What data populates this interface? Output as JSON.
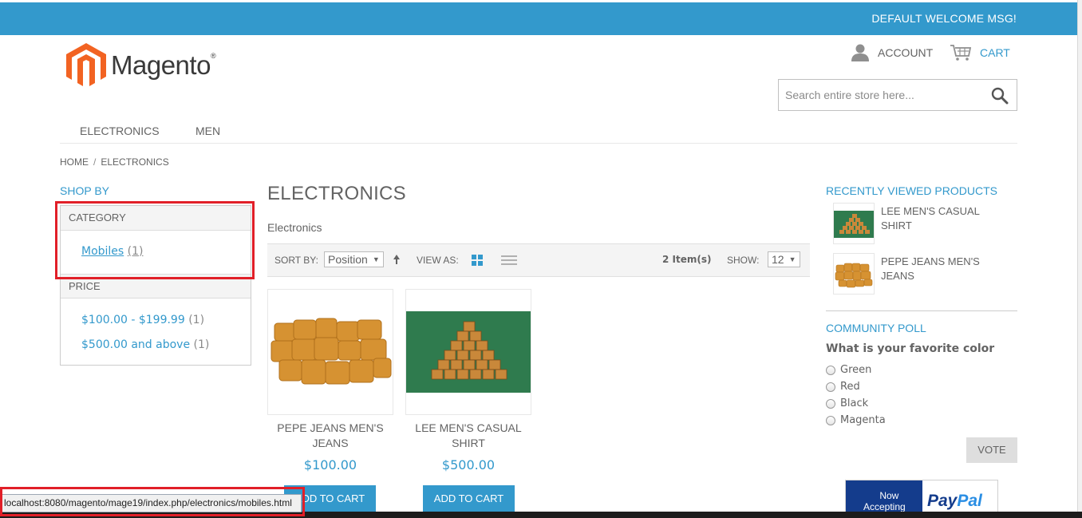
{
  "header": {
    "welcome": "DEFAULT WELCOME MSG!",
    "logo_text": "Magento",
    "logo_reg": "®",
    "account_label": "ACCOUNT",
    "cart_label": "CART",
    "search_placeholder": "Search entire store here..."
  },
  "nav": {
    "items": [
      "ELECTRONICS",
      "MEN"
    ]
  },
  "breadcrumb": {
    "home": "HOME",
    "separator": "/",
    "current": "ELECTRONICS"
  },
  "sidebar": {
    "shop_by": "SHOP BY",
    "category_heading": "CATEGORY",
    "category_link": "Mobiles",
    "category_count": "(1)",
    "price_heading": "PRICE",
    "price_ranges": [
      {
        "label": "$100.00 - $199.99",
        "count": "(1)"
      },
      {
        "label": "$500.00 and above",
        "count": "(1)"
      }
    ]
  },
  "main": {
    "title": "ELECTRONICS",
    "category_name": "Electronics",
    "toolbar": {
      "sort_by_label": "SORT BY:",
      "sort_value": "Position",
      "view_as_label": "VIEW AS:",
      "items_count": "2 Item(s)",
      "show_label": "SHOW:",
      "show_value": "12"
    },
    "products": [
      {
        "name": "PEPE JEANS MEN'S JEANS",
        "price": "$100.00",
        "button": "ADD TO CART"
      },
      {
        "name": "LEE MEN'S CASUAL SHIRT",
        "price": "$500.00",
        "button": "ADD TO CART"
      }
    ]
  },
  "right": {
    "recently_viewed_title": "RECENTLY VIEWED PRODUCTS",
    "recently_viewed": [
      "LEE MEN'S CASUAL SHIRT",
      "PEPE JEANS MEN'S JEANS"
    ],
    "poll_title": "COMMUNITY POLL",
    "poll_question": "What is your favorite color",
    "poll_options": [
      "Green",
      "Red",
      "Black",
      "Magenta"
    ],
    "vote_label": "VOTE",
    "paypal_now": "Now",
    "paypal_accepting": "Accepting",
    "paypal_brand_a": "Pay",
    "paypal_brand_b": "Pal"
  },
  "status_bar": {
    "url": "localhost:8080/magento/mage19/index.php/electronics/mobiles.html"
  },
  "colors": {
    "accent": "#3399cc",
    "highlight": "#e11f28",
    "logo": "#f26322"
  }
}
